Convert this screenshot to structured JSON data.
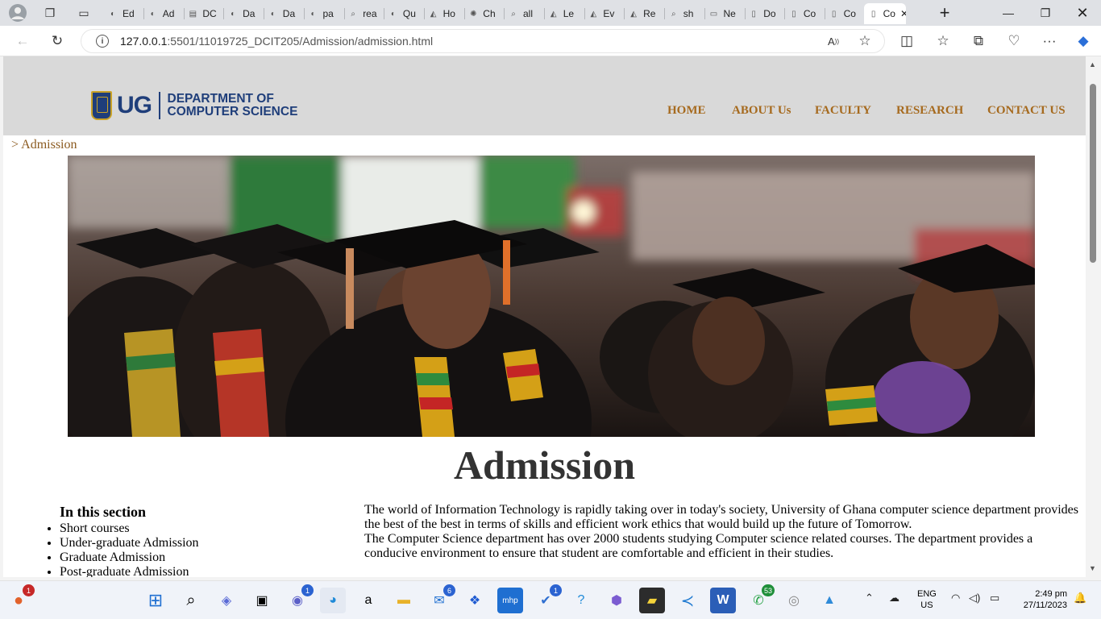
{
  "browser": {
    "tabs": [
      {
        "label": "Ed",
        "icon": "github-icon"
      },
      {
        "label": "Ad",
        "icon": "github-icon"
      },
      {
        "label": "DC",
        "icon": "docs-icon"
      },
      {
        "label": "Da",
        "icon": "github-icon"
      },
      {
        "label": "Da",
        "icon": "github-icon"
      },
      {
        "label": "pa",
        "icon": "github-icon"
      },
      {
        "label": "rea",
        "icon": "search-icon"
      },
      {
        "label": "Qu",
        "icon": "github-icon"
      },
      {
        "label": "Ho",
        "icon": "app-icon"
      },
      {
        "label": "Ch",
        "icon": "chatgpt-icon"
      },
      {
        "label": "all",
        "icon": "search-icon"
      },
      {
        "label": "Le",
        "icon": "app-icon"
      },
      {
        "label": "Ev",
        "icon": "app-icon"
      },
      {
        "label": "Re",
        "icon": "app-icon"
      },
      {
        "label": "sh",
        "icon": "search-icon"
      },
      {
        "label": "Ne",
        "icon": "newtab-icon"
      },
      {
        "label": "Do",
        "icon": "page-icon"
      },
      {
        "label": "Co",
        "icon": "page-icon"
      },
      {
        "label": "Co",
        "icon": "page-icon"
      },
      {
        "label": "Co",
        "icon": "page-icon",
        "active": true
      }
    ],
    "url_host": "127.0.0.1",
    "url_path": ":5501/11019725_DCIT205/Admission/admission.html"
  },
  "site": {
    "logo": {
      "ug": "UG",
      "line1": "DEPARTMENT OF",
      "line2": "COMPUTER SCIENCE"
    },
    "nav": {
      "home": "HOME",
      "about": "ABOUT Us",
      "faculty": "FACULTY",
      "research": "RESEARCH",
      "contact": "CONTACT US"
    },
    "breadcrumb": "> Admission",
    "title": "Admission",
    "section_heading": "In this section",
    "section_items": [
      "Short courses",
      "Under-graduate Admission",
      "Graduate Admission",
      "Post-graduate Admission"
    ],
    "intro_p1": "The world of Information Technology is rapidly taking over in today's society, University of Ghana computer science department provides the best of the best in terms of skills and efficient work ethics that would build up the future of Tomorrow.",
    "intro_p2": "The Computer Science department has over 2000 students studying Computer science related courses. The department provides a conducive environment to ensure that student are comfortable and efficient in their studies.",
    "colors": {
      "header_bg": "#d9d9d9",
      "nav_link": "#a66a1e",
      "brand_blue": "#1f3e7a"
    }
  },
  "taskbar": {
    "badges": {
      "brave": "1",
      "teams": "1",
      "mail": "6",
      "todo": "1",
      "whatsapp": "53"
    },
    "lang": "ENG",
    "region": "US",
    "time": "2:49 pm",
    "date": "27/11/2023"
  }
}
